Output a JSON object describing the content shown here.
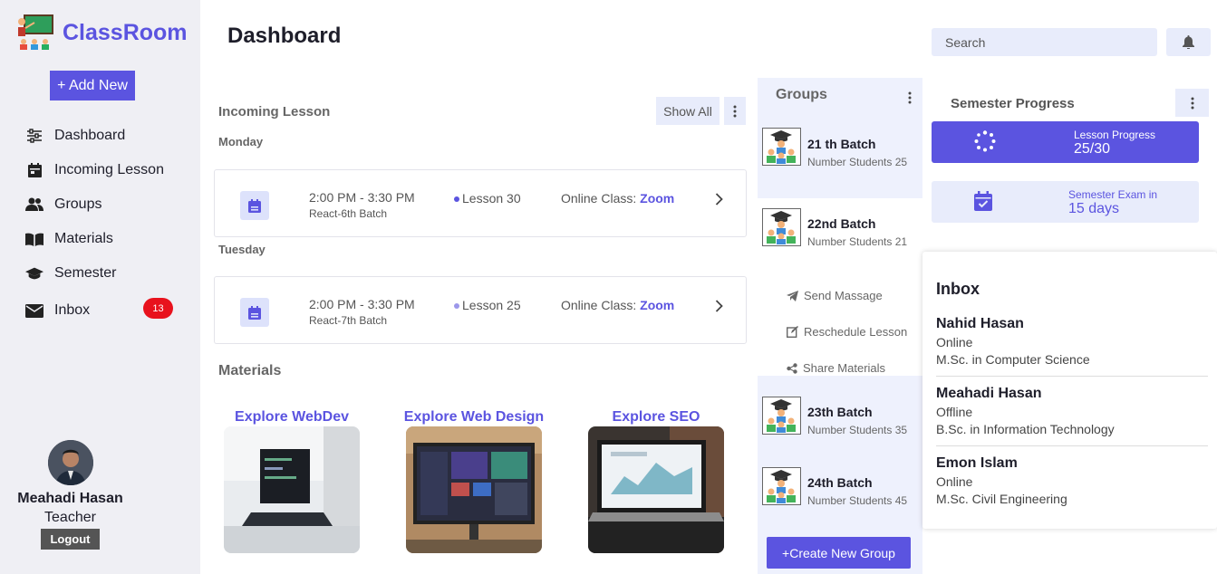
{
  "app": {
    "title": "ClassRoom",
    "add_new": "+ Add New"
  },
  "nav": [
    {
      "label": "Dashboard",
      "icon": "sliders-icon"
    },
    {
      "label": "Incoming Lesson",
      "icon": "calendar-icon"
    },
    {
      "label": "Groups",
      "icon": "users-icon"
    },
    {
      "label": "Materials",
      "icon": "book-icon"
    },
    {
      "label": "Semester",
      "icon": "graduation-cap-icon"
    },
    {
      "label": "Inbox",
      "icon": "envelope-icon",
      "badge": "13"
    }
  ],
  "user": {
    "name": "Meahadi Hasan",
    "role": "Teacher",
    "logout": "Logout"
  },
  "header": {
    "title": "Dashboard",
    "search_placeholder": "Search"
  },
  "incoming": {
    "title": "Incoming Lesson",
    "show_all": "Show All",
    "days": [
      {
        "day": "Monday",
        "time": "2:00 PM - 3:30 PM",
        "batch": "React-6th Batch",
        "lesson": "Lesson 30",
        "online": "Online Class:",
        "platform": "Zoom"
      },
      {
        "day": "Tuesday",
        "time": "2:00 PM - 3:30 PM",
        "batch": "React-7th Batch",
        "lesson": "Lesson 25",
        "online": "Online Class:",
        "platform": "Zoom"
      }
    ]
  },
  "materials": {
    "title": "Materials",
    "items": [
      {
        "title": "Explore WebDev"
      },
      {
        "title": "Explore Web Design"
      },
      {
        "title": "Explore SEO"
      }
    ]
  },
  "groups": {
    "title": "Groups",
    "items": [
      {
        "name": "21 th Batch",
        "count": "Number Students 25"
      },
      {
        "name": "22nd Batch",
        "count": "Number Students 21"
      },
      {
        "name": "23th Batch",
        "count": "Number Students 35"
      },
      {
        "name": "24th Batch",
        "count": "Number Students 45"
      }
    ],
    "actions": [
      {
        "label": "Send Massage",
        "icon": "paper-plane-icon"
      },
      {
        "label": "Reschedule Lesson",
        "icon": "edit-icon"
      },
      {
        "label": "Share Materials",
        "icon": "share-icon"
      }
    ],
    "create": "+Create New Group"
  },
  "semester": {
    "title": "Semester Progress",
    "lesson_label": "Lesson Progress",
    "lesson_value": "25/30",
    "exam_label": "Semester Exam in",
    "exam_value": "15 days"
  },
  "inbox": {
    "title": "Inbox",
    "messages": [
      {
        "name": "Nahid Hasan",
        "status": "Online",
        "degree": "M.Sc. in Computer Science"
      },
      {
        "name": "Meahadi Hasan",
        "status": "Offline",
        "degree": "B.Sc. in Information Technology"
      },
      {
        "name": "Emon Islam",
        "status": "Online",
        "degree": "M.Sc. Civil Engineering"
      }
    ]
  },
  "colors": {
    "accent": "#5b54e0",
    "badge": "#e8121d",
    "panel": "#eef1fd"
  }
}
